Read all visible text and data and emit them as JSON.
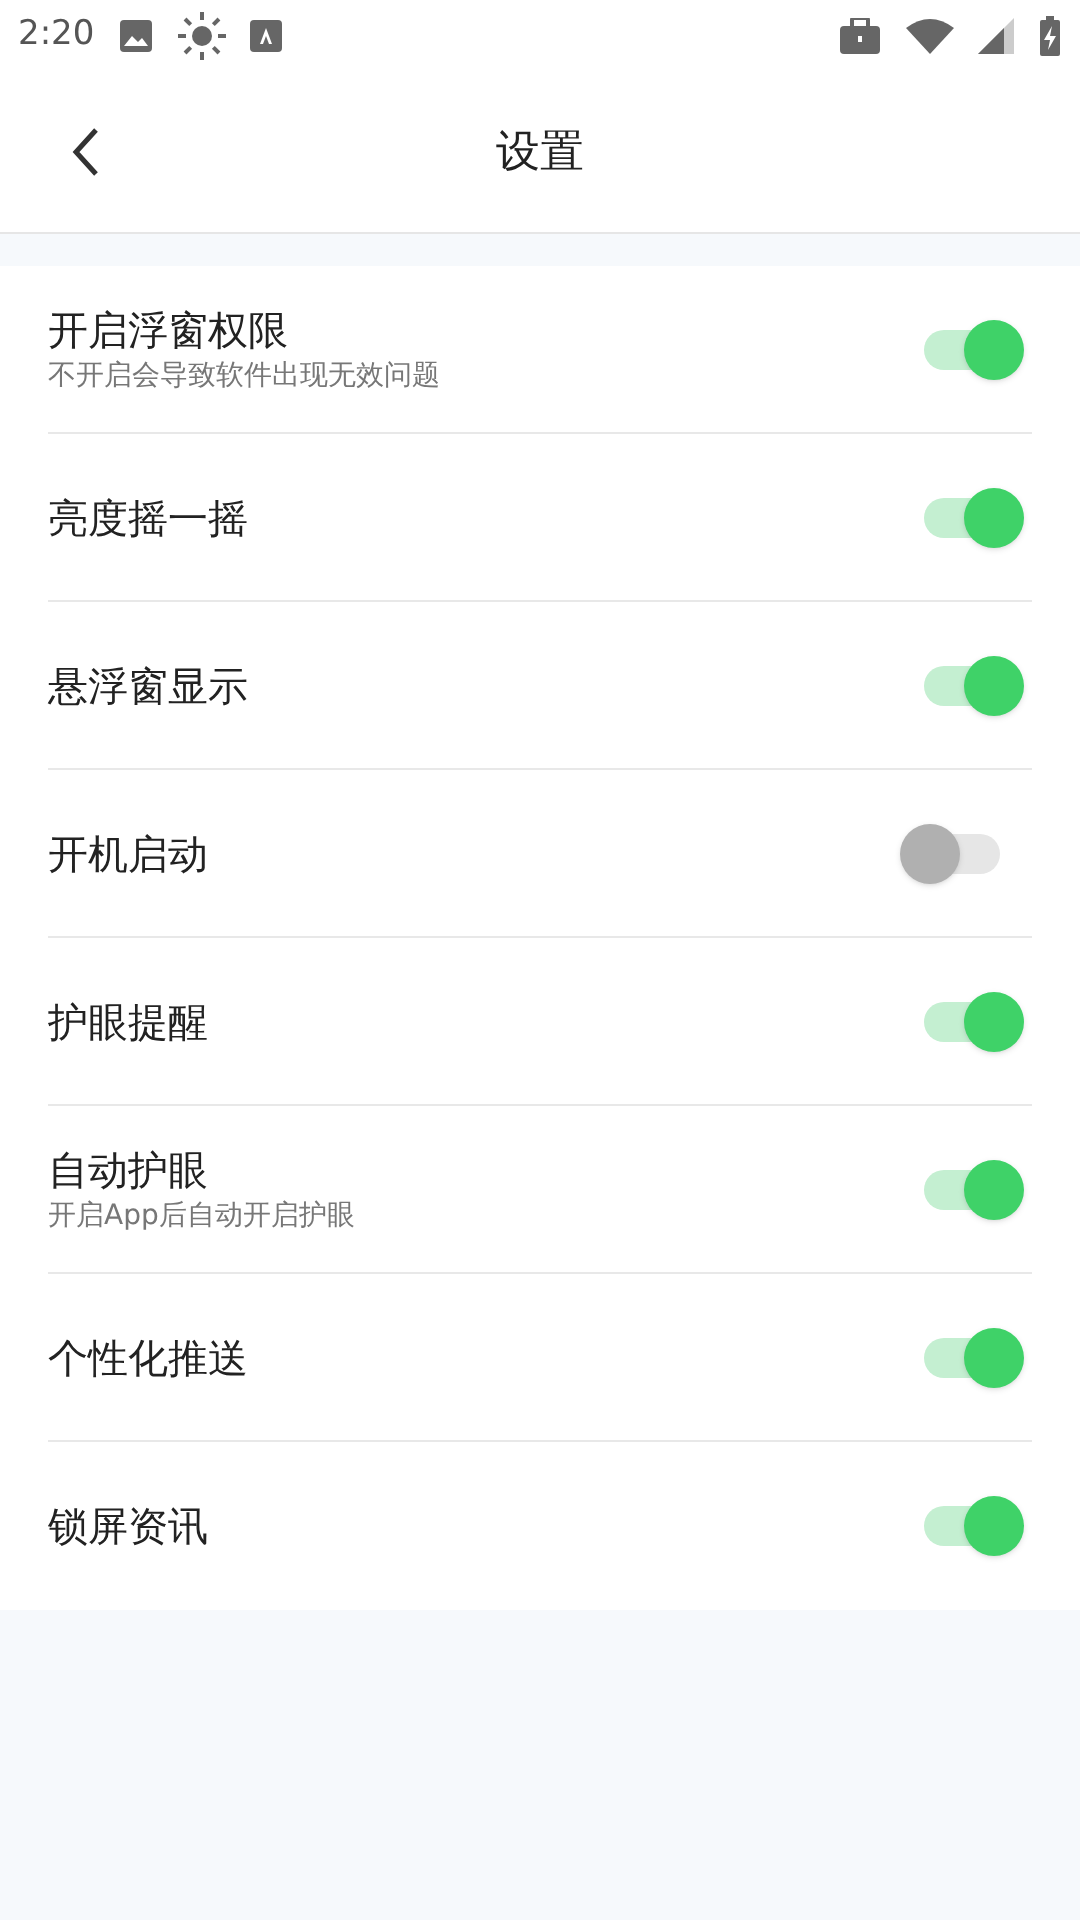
{
  "status_bar": {
    "time": "2:20"
  },
  "header": {
    "title": "设置"
  },
  "settings": [
    {
      "label": "开启浮窗权限",
      "subtitle": "不开启会导致软件出现无效问题",
      "on": true
    },
    {
      "label": "亮度摇一摇",
      "on": true
    },
    {
      "label": "悬浮窗显示",
      "on": true
    },
    {
      "label": "开机启动",
      "on": false
    },
    {
      "label": "护眼提醒",
      "on": true
    },
    {
      "label": "自动护眼",
      "subtitle": "开启App后自动开启护眼",
      "on": true
    },
    {
      "label": "个性化推送",
      "on": true
    },
    {
      "label": "锁屏资讯",
      "on": true
    }
  ]
}
